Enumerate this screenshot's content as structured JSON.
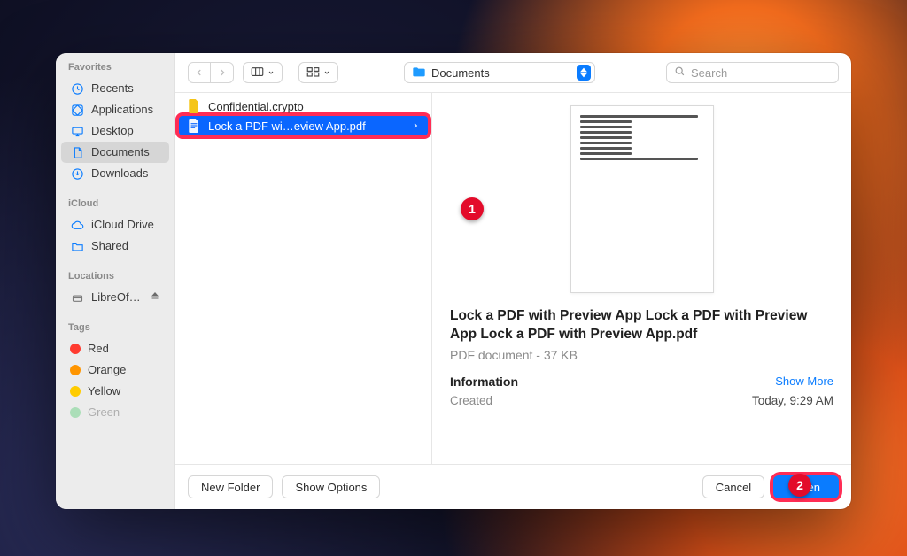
{
  "sidebar": {
    "sections": {
      "favorites": {
        "label": "Favorites"
      },
      "icloud": {
        "label": "iCloud"
      },
      "locations": {
        "label": "Locations"
      },
      "tags": {
        "label": "Tags"
      }
    },
    "favorites": [
      {
        "label": "Recents"
      },
      {
        "label": "Applications"
      },
      {
        "label": "Desktop"
      },
      {
        "label": "Documents"
      },
      {
        "label": "Downloads"
      }
    ],
    "icloud": [
      {
        "label": "iCloud Drive"
      },
      {
        "label": "Shared"
      }
    ],
    "locations": [
      {
        "label": "LibreOf…"
      }
    ],
    "tags": [
      {
        "label": "Red",
        "color": "#ff3b30"
      },
      {
        "label": "Orange",
        "color": "#ff9500"
      },
      {
        "label": "Yellow",
        "color": "#ffcc00"
      },
      {
        "label": "Green",
        "color": "#34c759"
      }
    ]
  },
  "toolbar": {
    "location_label": "Documents",
    "search_placeholder": "Search"
  },
  "files": [
    {
      "name": "Confidential.crypto",
      "selected": false
    },
    {
      "name": "Lock a PDF wi…eview App.pdf",
      "selected": true
    }
  ],
  "preview": {
    "title": "Lock a PDF with Preview App Lock a PDF with Preview App Lock a PDF with Preview App.pdf",
    "subtitle": "PDF document - 37 KB",
    "info_label": "Information",
    "show_more": "Show More",
    "created_label": "Created",
    "created_value": "Today, 9:29 AM"
  },
  "footer": {
    "new_folder": "New Folder",
    "show_options": "Show Options",
    "cancel": "Cancel",
    "open": "Open"
  },
  "annotations": {
    "one": "1",
    "two": "2"
  }
}
